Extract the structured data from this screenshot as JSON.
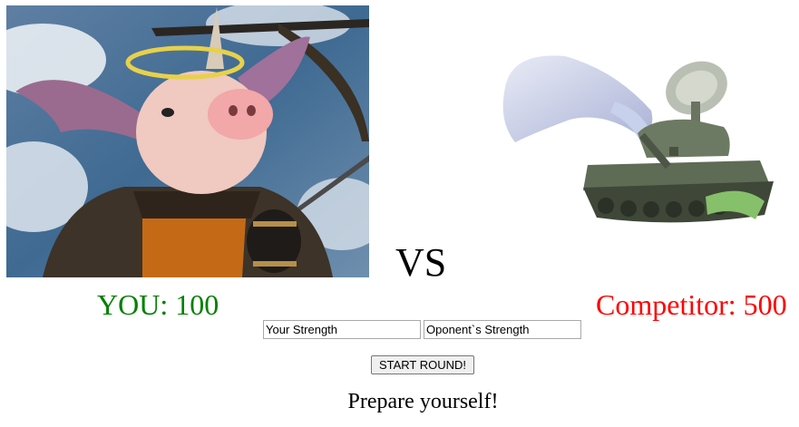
{
  "vs_label": "VS",
  "player": {
    "label": "YOU: 100",
    "color": "#008000"
  },
  "competitor": {
    "label": "Competitor: 500",
    "color": "#ff0000"
  },
  "inputs": {
    "your_strength_placeholder": "Your Strength",
    "opponent_strength_placeholder": "Oponent`s Strength"
  },
  "start_button_label": "START ROUND!",
  "status_message": "Prepare yourself!",
  "images": {
    "player": "winged-pig-warrior-with-halo-and-unicorn-horn",
    "opponent": "tank-with-radar-dish-and-smoke-plume"
  }
}
